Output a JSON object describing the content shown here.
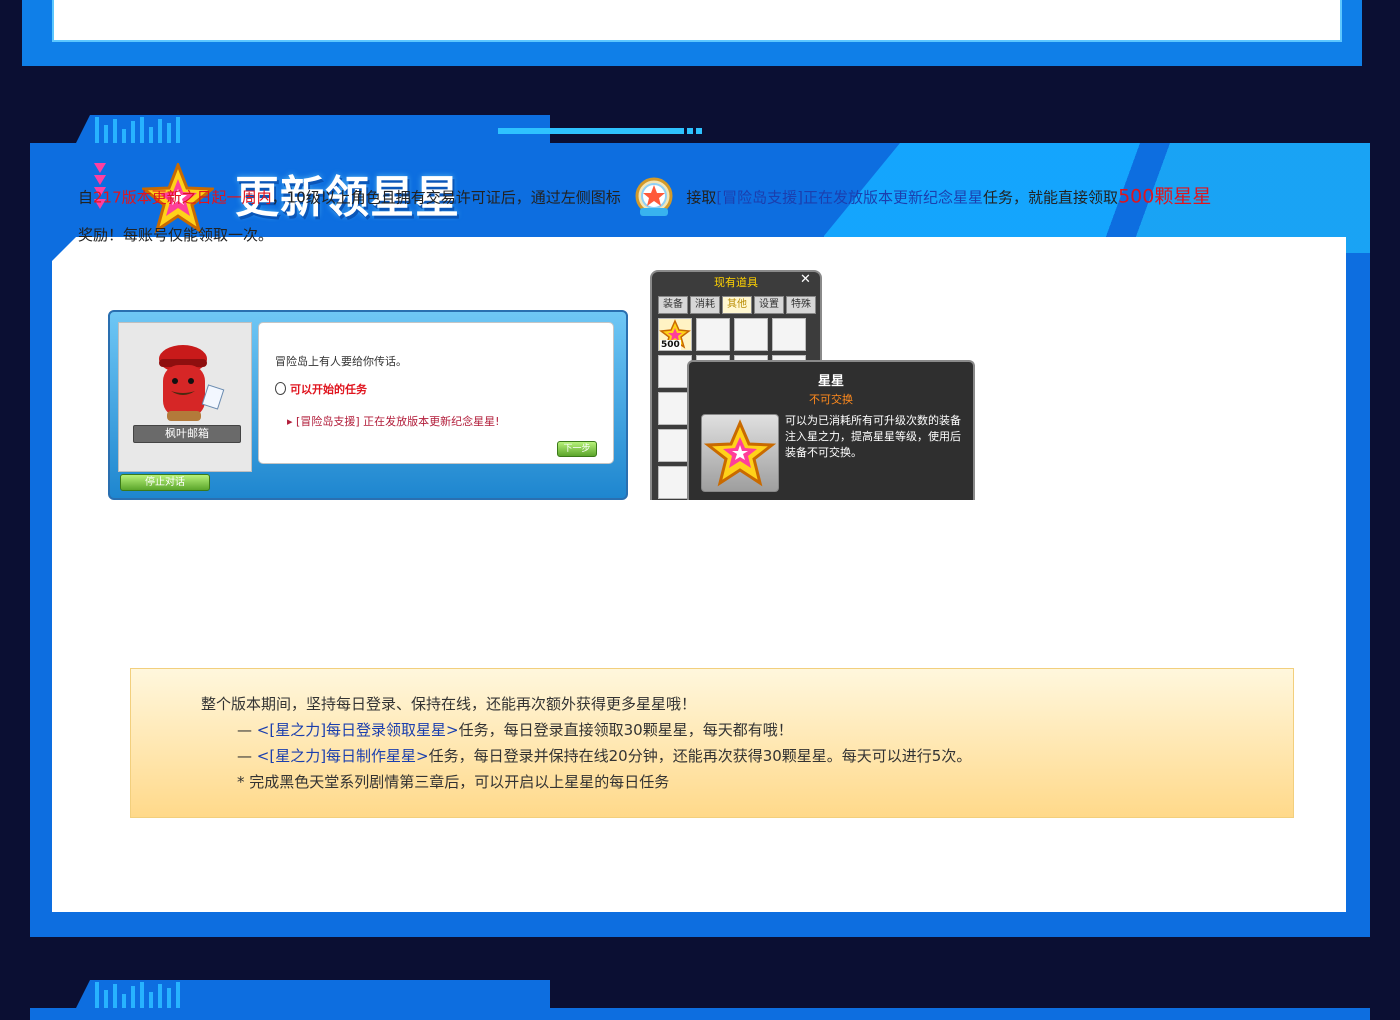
{
  "section": {
    "title": "更新领星星"
  },
  "intro": {
    "part1": "自",
    "highlight_period": "217版本更新之日起一周内",
    "part2": "，10级以上角色且拥有交易许可证后，通过左侧图标",
    "part3": "接取",
    "quest_name": "[冒险岛支援]正在发放版本更新纪念星星",
    "part4": "任务，就能直接领取",
    "reward": "500颗星星",
    "part5": "奖励！每账号仅能领取一次。"
  },
  "dialog": {
    "npc_name": "枫叶邮箱",
    "message": "冒险岛上有人要给你传话。",
    "available_label": "可以开始的任务",
    "quest_entry": "[冒险岛支援] 正在发放版本更新纪念星星!",
    "next_button": "下一步",
    "stop_button": "停止对话"
  },
  "inventory": {
    "title": "现有道具",
    "tabs": [
      "装备",
      "消耗",
      "其他",
      "设置",
      "特殊"
    ],
    "active_tab": "其他",
    "item_count": "500"
  },
  "tooltip": {
    "title": "星星",
    "subtitle": "不可交换",
    "description": "可以为已消耗所有可升级次数的装备注入星之力，提高星星等级，使用后装备不可交换。"
  },
  "note": {
    "line1": "整个版本期间，坚持每日登录、保持在线，还能再次额外获得更多星星哦！",
    "line2_prefix": "— ",
    "line2_quest": "<[星之力]每日登录领取星星>",
    "line2_suffix": "任务，每日登录直接领取30颗星星，每天都有哦！",
    "line3_prefix": "— ",
    "line3_quest": "<[星之力]每日制作星星>",
    "line3_suffix": "任务，每日登录并保持在线20分钟，还能再次获得30颗星星。每天可以进行5次。",
    "line4": "* 完成黑色天堂系列剧情第三章后，可以开启以上星星的每日任务"
  },
  "colors": {
    "accent_blue": "#0d6ee0",
    "highlight_red": "#e0141e",
    "quest_blue": "#1b3fae",
    "page_bg": "#0b0f33"
  }
}
